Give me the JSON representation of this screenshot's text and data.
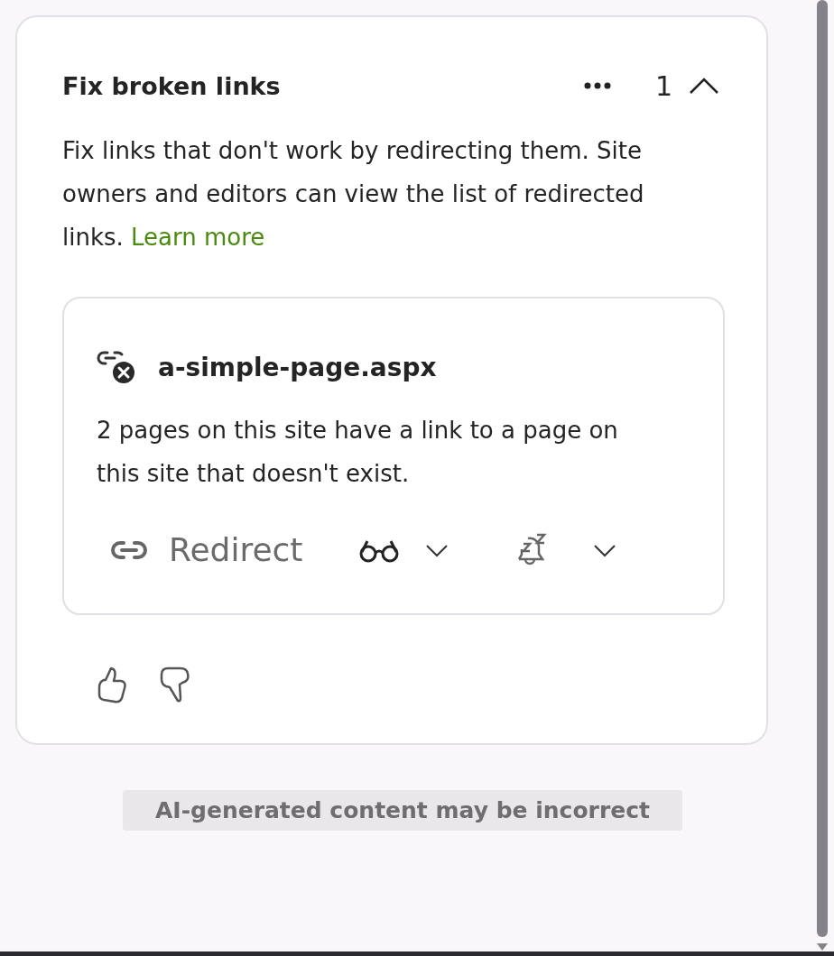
{
  "card": {
    "title": "Fix broken links",
    "count": "1",
    "expanded": true,
    "description": "Fix links that don't work by redirecting them. Site owners and editors can view the list of redirected links.",
    "link": "Learn more",
    "issue": {
      "filename": "a-simple-page.aspx",
      "text": "2 pages on this site have a link to a page on this site that doesn't exist.",
      "actions": [
        {
          "kind": "button",
          "label": "Redirect"
        },
        {
          "kind": "view-menu"
        },
        {
          "kind": "snooze-menu"
        }
      ]
    }
  },
  "disclaimer": "AI-generated content may be incorrect"
}
